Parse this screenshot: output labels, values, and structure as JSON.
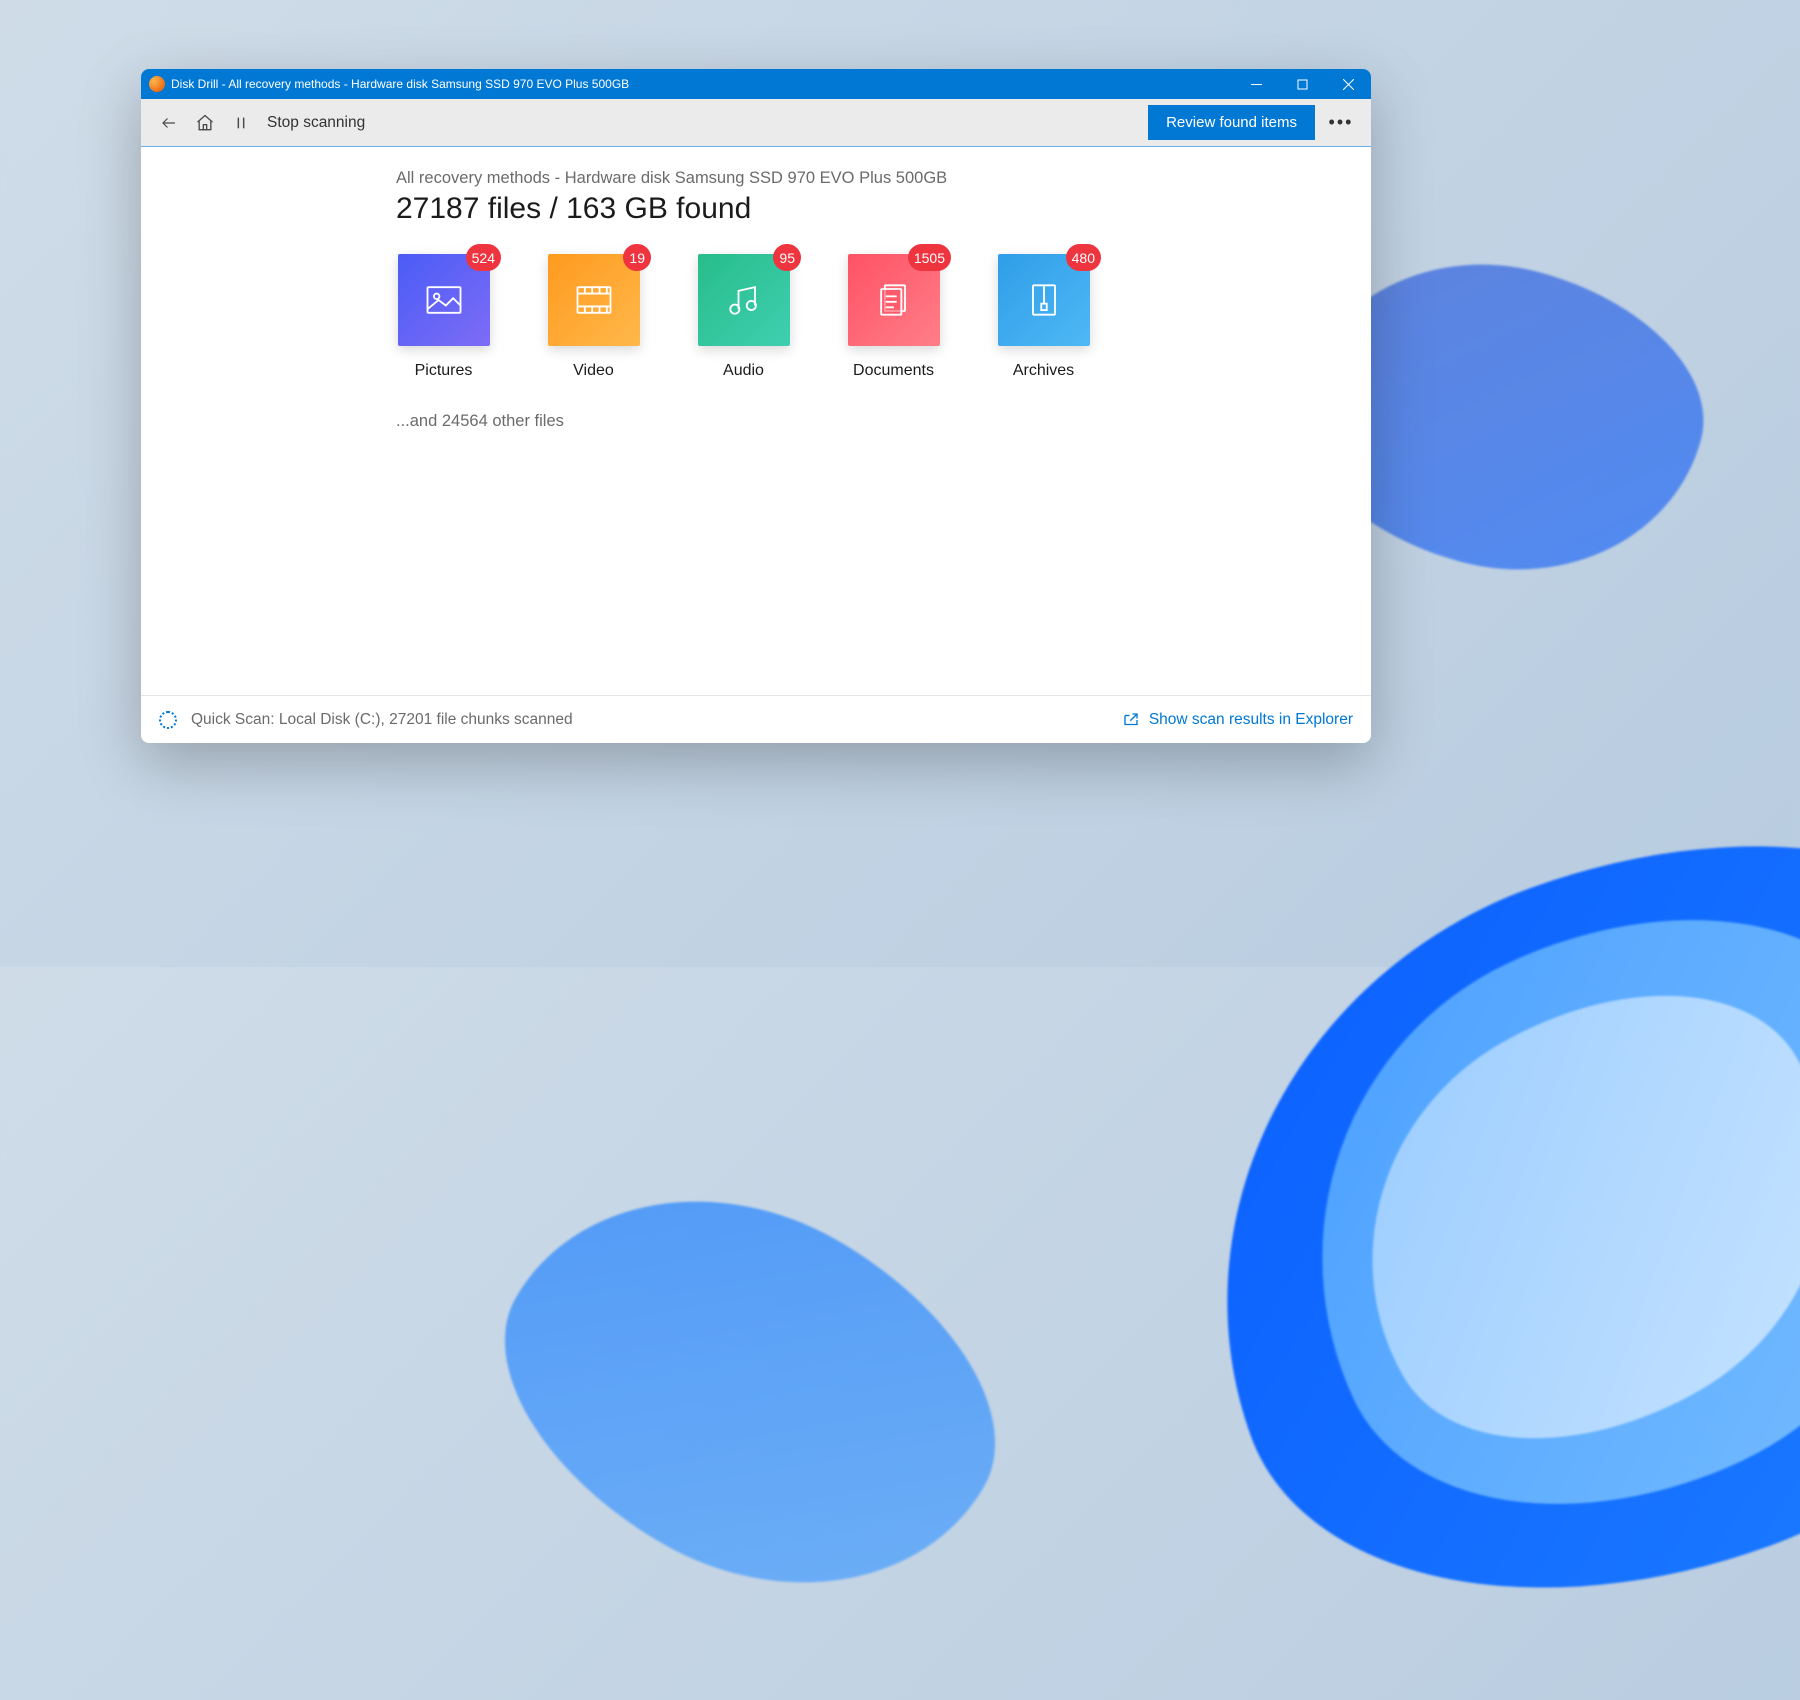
{
  "window": {
    "title": "Disk Drill - All recovery methods - Hardware disk Samsung SSD 970 EVO Plus 500GB"
  },
  "toolbar": {
    "stop_label": "Stop scanning",
    "review_label": "Review found items"
  },
  "main": {
    "subtitle": "All recovery methods - Hardware disk Samsung SSD 970 EVO Plus 500GB",
    "heading": "27187 files / 163 GB found",
    "categories": [
      {
        "label": "Pictures",
        "badge": "524"
      },
      {
        "label": "Video",
        "badge": "19"
      },
      {
        "label": "Audio",
        "badge": "95"
      },
      {
        "label": "Documents",
        "badge": "1505"
      },
      {
        "label": "Archives",
        "badge": "480"
      }
    ],
    "other_files": "...and 24564 other files"
  },
  "status": {
    "text": "Quick Scan: Local Disk (C:), 27201 file chunks scanned",
    "explorer_link": "Show scan results in Explorer"
  }
}
